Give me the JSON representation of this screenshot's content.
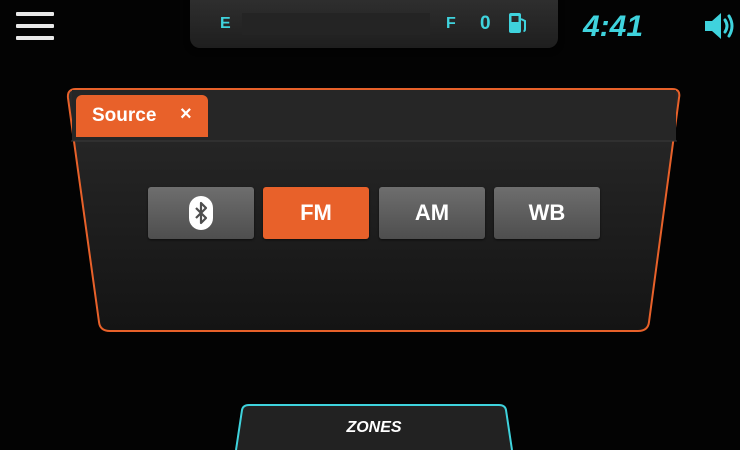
{
  "header": {
    "menu_icon": "hamburger-menu-icon",
    "fuel": {
      "empty_label": "E",
      "full_label": "F",
      "value": "0",
      "icon": "fuel-pump-icon"
    },
    "clock": "4:41",
    "volume_icon": "speaker-volume-icon",
    "accent_color": "#3fd3dd"
  },
  "source_panel": {
    "tab_label": "Source",
    "close_label": "×",
    "accent_color": "#e8612a",
    "buttons": [
      {
        "label": "",
        "icon": "bluetooth-icon",
        "active": false
      },
      {
        "label": "FM",
        "active": true
      },
      {
        "label": "AM",
        "active": false
      },
      {
        "label": "WB",
        "active": false
      }
    ]
  },
  "footer": {
    "zones_label": "ZONES"
  }
}
